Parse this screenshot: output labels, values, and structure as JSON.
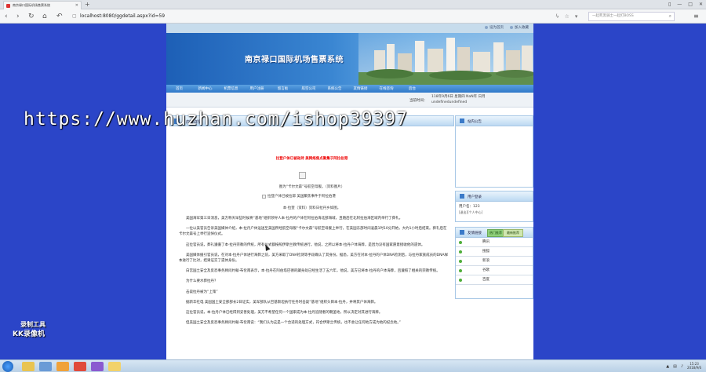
{
  "browser": {
    "tab_title": "南京禄口国际机场售票系统",
    "url": "localhost:8080/ggdetail.aspx?id=59",
    "search_placeholder": "一起死黑骑士一起打BOSS"
  },
  "site": {
    "top_links": [
      "设为首页",
      "加入收藏"
    ],
    "banner_title": "南京禄口国际机场售票系统",
    "nav": [
      "首页",
      "新闻中心",
      "机票信息",
      "用户注册",
      "留言板",
      "航空公司",
      "系统公告",
      "友情链接",
      "在线咨询",
      "后台"
    ],
    "current_time_label": "当前时间：",
    "current_time_value": "118年9月6日 星期四 NaN年 日月 undefinedundefined"
  },
  "main": {
    "panel_title": "内容详情",
    "red_line": "拉登户体已被劫持 美网络焦点聚集于阿拉伯港",
    "image_caption_1": "图为“卡尔文森”号航空母舰。（资料图片）",
    "image_alt_2": "拉登户体已被拉耶 美国聚焦事件于阿拉伯港",
    "image_caption_2": "本·拉登（资料）资料日拉丹乡如图。",
    "paragraphs": [
      "美国海军第三日消息，美方称天早些时候将“基地”组织领导人本·拉丹的户体在阿拉伯海北部海域，且随后在北阿拉伯海区域内举行了葬礼。",
      "一位以美官员告诉美国媒体介绍，本·拉丹户体运送至美国所经航空母舰“卡尔文森”号航空母舰上举行，在美国东部时间凌晨1时10分开始，大约1小时后结束。葬礼后在卡尔文森号上举行追悼仪式。",
      "这位官员说，葬礼遵循了本·拉丹宗教的传统，所有仪式都按照伊斯兰教传统进行。他说，之所以将本·拉丹户体海葬，是因为没有国家愿意接收他的遗体。",
      "美国媒体援引官员说，在对本·拉丹户体进行海葬之前，美方采取了DNA检测等手段确认了其身份。据悉，美方在对本·拉丹的户体DNA检测后，与拉丹家族成员的DNA样本进行了比对，结果证实了遗体身份。",
      "白宫国土安全及反恐事务顾问约翰·布伦南表示，本·拉丹在阿伯塔巴德的藏身处已经生活了五六年，他说，美方已将本·拉丹的户体海葬，且遵照了相关的宗教传统。",
      "为什么要水葬拉丹？",
      "击毙拉丹被为“上策”",
      "据新华社电 美国国土安全部部长2日证实，美军部队从巴基斯坦执行任务时击毙“基地”组织头目本·拉丹，并将其户体海葬。",
      "这位官员说，本·拉丹户体已经得到妥善处理，美方不希望任何一个国家成为本·拉丹追随者的朝圣地，所以决定对其进行海葬。",
      "但美国土安全及反恐事务顾问约翰·布伦南说：“我们认为这是一个合适的处理方式，符合伊斯兰传统，也不会让任何地方成为他的纪念地。”"
    ]
  },
  "sidebar": {
    "box1_title": "站内公告",
    "box2_title": "用户登录",
    "box2_line1": "用户名：123",
    "box2_line2": "[退出][个人中心]",
    "box3_title": "友情链接",
    "box3_tab1": "热门推荐",
    "box3_tab2": "最新推荐",
    "links": [
      "腾讯",
      "搜狐",
      "新浪",
      "谷歌",
      "百度"
    ]
  },
  "watermark": {
    "url_text": "https://www.huzhan.com/ishop39397",
    "rec_line1": "录制工具",
    "rec_line2": "KK录像机"
  },
  "taskbar": {
    "time": "15:23",
    "date": "2018/9/6"
  },
  "colors": {
    "page_bg": "#2b45c8",
    "banner_blue": "#1d5fb6",
    "red_text": "#ee0000",
    "nav_blue": "#2f78c8"
  }
}
